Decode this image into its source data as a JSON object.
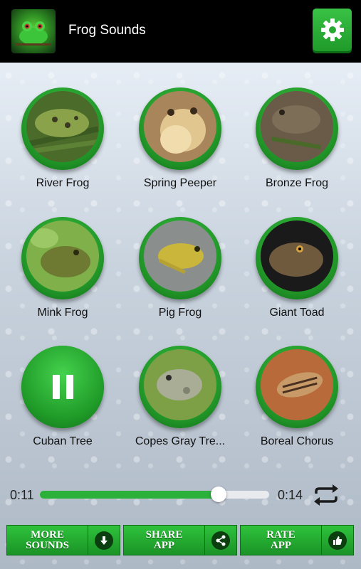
{
  "header": {
    "title": "Frog Sounds"
  },
  "sounds": [
    {
      "label": "River Frog"
    },
    {
      "label": "Spring Peeper"
    },
    {
      "label": "Bronze Frog"
    },
    {
      "label": "Mink Frog"
    },
    {
      "label": "Pig Frog"
    },
    {
      "label": "Giant Toad"
    },
    {
      "label": "Cuban Tree"
    },
    {
      "label": "Copes Gray Tre..."
    },
    {
      "label": "Boreal Chorus"
    }
  ],
  "player": {
    "elapsed": "0:11",
    "total": "0:14",
    "progress_fraction": 0.78
  },
  "actions": {
    "more_sounds_line1": "MORE",
    "more_sounds_line2": "SOUNDS",
    "share_line1": "SHARE",
    "share_line2": "APP",
    "rate_line1": "RATE",
    "rate_line2": "APP"
  },
  "colors": {
    "accent": "#2bb03a",
    "appbar": "#000000"
  }
}
